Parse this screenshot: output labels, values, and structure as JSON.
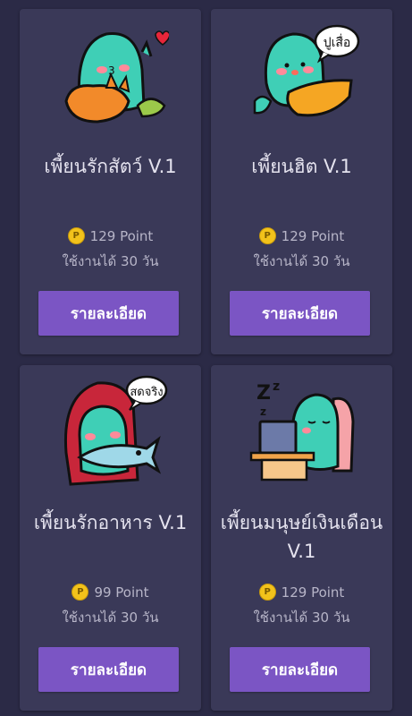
{
  "stickers": [
    {
      "title": "เพี้ยนรักสัตว์ V.1",
      "price": "129 Point",
      "duration": "ใช้งานได้ 30 วัน",
      "button": "รายละเอียด"
    },
    {
      "title": "เพี้ยนฮิต V.1",
      "price": "129 Point",
      "duration": "ใช้งานได้ 30 วัน",
      "button": "รายละเอียด",
      "bubble_text": "ปูเสื่อ"
    },
    {
      "title": "เพี้ยนรักอาหาร V.1",
      "price": "99 Point",
      "duration": "ใช้งานได้ 30 วัน",
      "button": "รายละเอียด",
      "bubble_text": "สดจริง"
    },
    {
      "title": "เพี้ยนมนุษย์เงินเดือน V.1",
      "price": "129 Point",
      "duration": "ใช้งานได้ 30 วัน",
      "button": "รายละเอียด"
    }
  ],
  "coin_symbol": "P",
  "colors": {
    "background": "#2b2a46",
    "card": "#3a3958",
    "button": "#7b55c4",
    "coin": "#f2c21b",
    "character": "#3fcfb6"
  }
}
